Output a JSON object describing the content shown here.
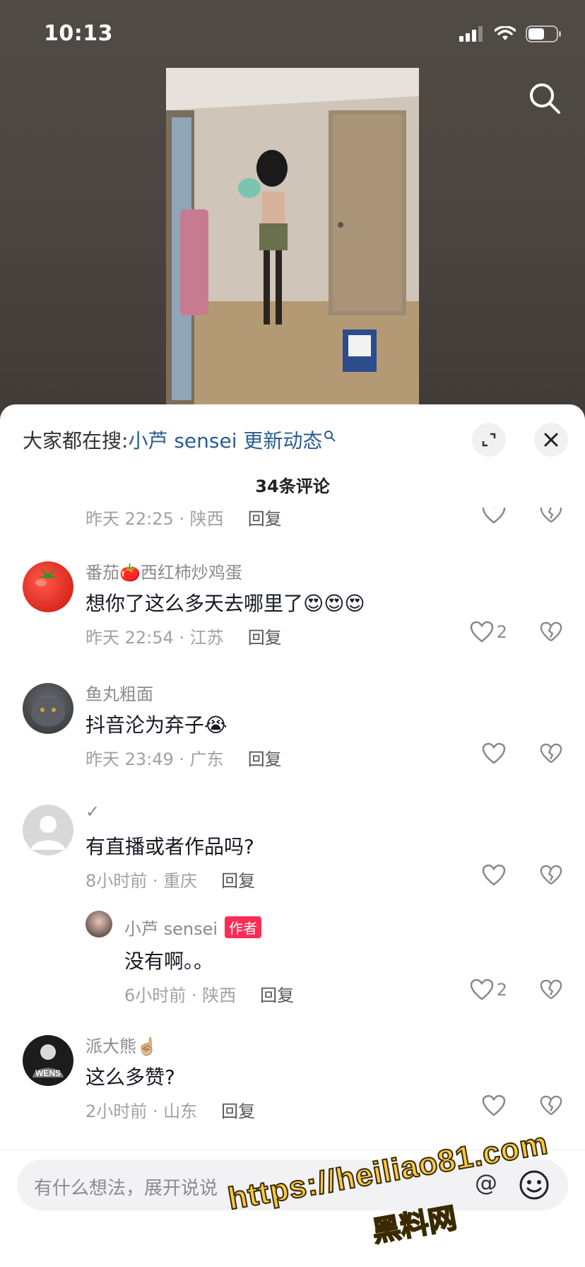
{
  "status": {
    "time": "10:13"
  },
  "sheet": {
    "search_prefix": "大家都在搜:",
    "search_keyword": "小芦 sensei 更新动态",
    "comment_count": "34条评论"
  },
  "comments": [
    {
      "meta_time": "昨天 22:25 · 陕西",
      "reply": "回复"
    },
    {
      "name": "番茄🍅西红柿炒鸡蛋",
      "text": "想你了这么多天去哪里了😍😍😍",
      "meta_time": "昨天 22:54 · 江苏",
      "reply": "回复",
      "likes": "2"
    },
    {
      "name": "鱼丸粗面",
      "text": "抖音沦为弃子😭",
      "meta_time": "昨天 23:49 · 广东",
      "reply": "回复"
    },
    {
      "name": "✓",
      "text": "有直播或者作品吗?",
      "meta_time": "8小时前 · 重庆",
      "reply": "回复"
    },
    {
      "name": "小芦 sensei",
      "badge": "作者",
      "text": "没有啊。。",
      "meta_time": "6小时前 · 陕西",
      "reply": "回复",
      "likes": "2"
    },
    {
      "name": "派大熊☝🏼",
      "text": "这么多赞?",
      "meta_time": "2小时前 · 山东",
      "reply": "回复"
    }
  ],
  "input": {
    "placeholder": "有什么想法，展开说说",
    "at_symbol": "@"
  },
  "watermark": {
    "url": "https://heiliao81.com",
    "name": "黑料网"
  },
  "avatar_texts": {
    "wens": "WENS"
  },
  "colors": {
    "author_badge": "#fe2c55",
    "keyword": "#2a5c92",
    "watermark": "#f7c84a"
  }
}
